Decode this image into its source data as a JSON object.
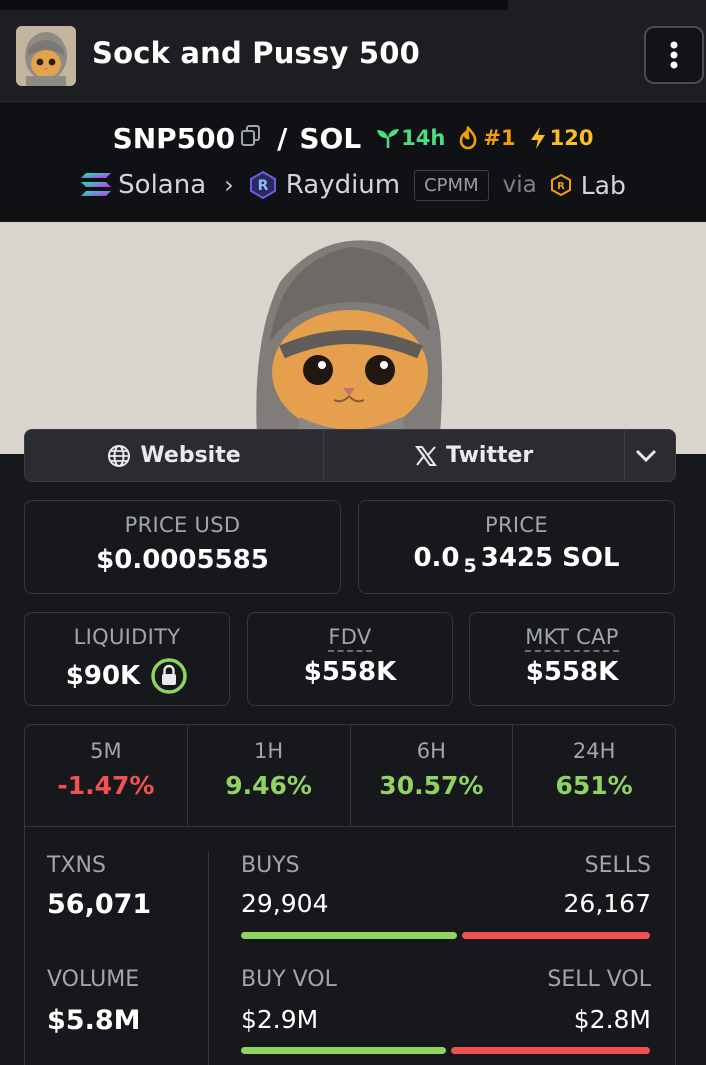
{
  "header": {
    "title": "Sock and Pussy 500",
    "avatar_icon": "cat-avatar-icon",
    "menu_icon": "kebab-menu-icon"
  },
  "pair": {
    "base": "SNP500",
    "separator": "/",
    "quote": "SOL",
    "age": "14h",
    "rank": "#1",
    "boosts": "120",
    "chain": "Solana",
    "dex": "Raydium",
    "pool_type": "CPMM",
    "via": "via",
    "launchpad": "Lab"
  },
  "links": {
    "website": "Website",
    "twitter": "Twitter"
  },
  "metrics": {
    "price_usd_label": "PRICE USD",
    "price_usd": "$0.0005585",
    "price_label": "PRICE",
    "price_prefix": "0.0",
    "price_zeros": "5",
    "price_digits": "3425 SOL",
    "liquidity_label": "LIQUIDITY",
    "liquidity": "$90K",
    "fdv_label": "FDV",
    "fdv": "$558K",
    "mktcap_label": "MKT CAP",
    "mktcap": "$558K"
  },
  "changes": [
    {
      "label": "5M",
      "value": "-1.47%"
    },
    {
      "label": "1H",
      "value": "9.46%"
    },
    {
      "label": "6H",
      "value": "30.57%"
    },
    {
      "label": "24H",
      "value": "651%"
    }
  ],
  "txns": {
    "txns_label": "TXNS",
    "txns": "56,071",
    "buys_label": "BUYS",
    "buys": "29,904",
    "sells_label": "SELLS",
    "sells": "26,167",
    "buy_share": 0.533,
    "volume_label": "VOLUME",
    "volume": "$5.8M",
    "buy_vol_label": "BUY VOL",
    "buy_vol": "$2.9M",
    "sell_vol_label": "SELL VOL",
    "sell_vol": "$2.8M",
    "buy_vol_share": 0.505
  },
  "colors": {
    "positive": "#8fd460",
    "negative": "#f05252",
    "age": "#4ade80",
    "rank": "#f59e0b"
  }
}
